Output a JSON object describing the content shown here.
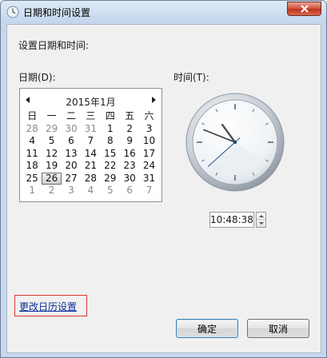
{
  "window": {
    "title": "日期和时间设置",
    "close_icon": "close-icon"
  },
  "content": {
    "heading": "设置日期和时间:",
    "date_label": "日期(D):",
    "time_label": "时间(T):"
  },
  "calendar": {
    "month_title": "2015年1月",
    "weekdays": [
      "日",
      "一",
      "二",
      "三",
      "四",
      "五",
      "六"
    ],
    "weeks": [
      [
        "28",
        "29",
        "30",
        "31",
        "1",
        "2",
        "3"
      ],
      [
        "4",
        "5",
        "6",
        "7",
        "8",
        "9",
        "10"
      ],
      [
        "11",
        "12",
        "13",
        "14",
        "15",
        "16",
        "17"
      ],
      [
        "18",
        "19",
        "20",
        "21",
        "22",
        "23",
        "24"
      ],
      [
        "25",
        "26",
        "27",
        "28",
        "29",
        "30",
        "31"
      ],
      [
        "1",
        "2",
        "3",
        "4",
        "5",
        "6",
        "7"
      ]
    ],
    "selected_day": "26"
  },
  "clock": {
    "hour": 10,
    "minute": 48,
    "second": 38
  },
  "time_field": {
    "value": "10:48:38"
  },
  "links": {
    "change_calendar": "更改日历设置"
  },
  "buttons": {
    "ok": "确定",
    "cancel": "取消"
  },
  "colors": {
    "link": "#0b2f9c",
    "highlight_border": "#d9372f",
    "title_close": "#c0321c"
  }
}
